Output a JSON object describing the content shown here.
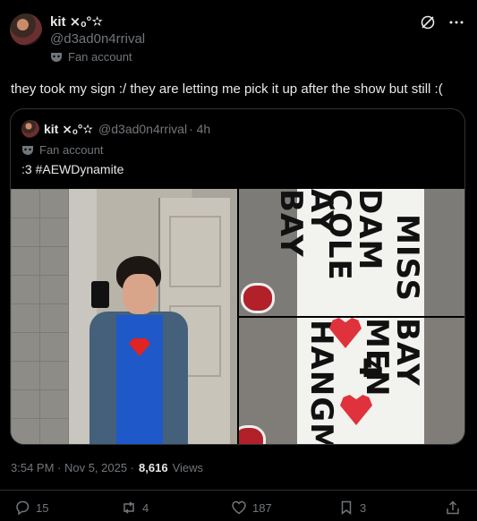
{
  "author": {
    "name": "kit ⨯ₒ°✫",
    "handle": "@d3ad0n4rrival",
    "badge": "Fan account"
  },
  "tweet": {
    "text": "they took my sign :/ they are letting me pick it up after the show but still :("
  },
  "quote": {
    "name": "kit ⨯ₒ°✫",
    "handle": "@d3ad0n4rrival",
    "time": "· 4h",
    "badge": "Fan account",
    "text": ":3 #AEWDynamite"
  },
  "sign_top": {
    "line1": "MISS",
    "line2": "DAM COLE",
    "line3": "AY BAY"
  },
  "sign_bottom": {
    "line1": "BAY MEN",
    "line2": "4",
    "line3": "HANGMAN"
  },
  "meta": {
    "time": "3:54 PM · Nov 5, 2025 ·",
    "views_count": "8,616",
    "views_label": "Views"
  },
  "actions": {
    "replies": "15",
    "reposts": "4",
    "likes": "187",
    "bookmarks": "3"
  },
  "icons": [
    "mask-icon",
    "grok-icon",
    "more-icon",
    "reply-icon",
    "repost-icon",
    "like-icon",
    "bookmark-icon",
    "share-icon"
  ],
  "colors": {
    "background": "#000000",
    "text": "#e7e9ea",
    "muted": "#71767b",
    "border": "#2f3336"
  }
}
